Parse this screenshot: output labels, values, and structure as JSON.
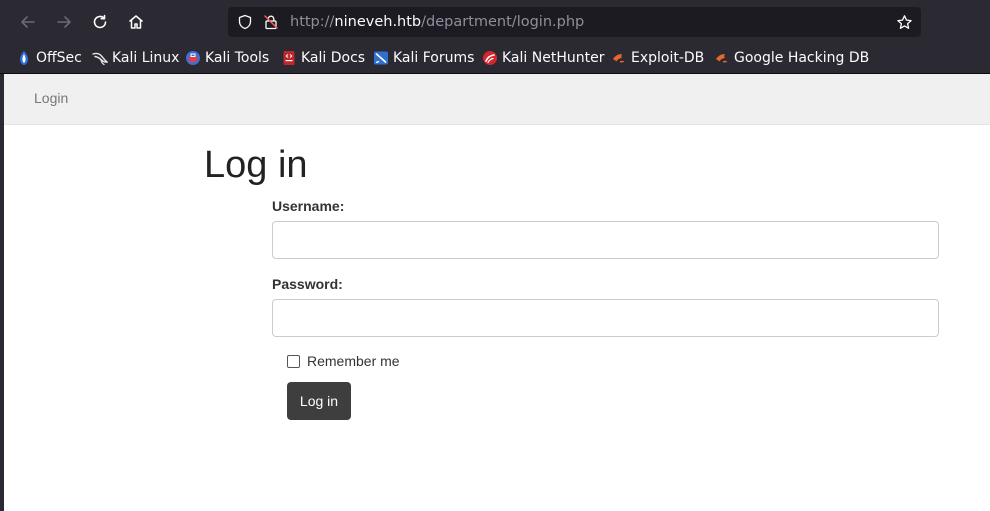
{
  "browser": {
    "url_scheme": "http://",
    "url_host": "nineveh.htb",
    "url_path": "/department/login.php",
    "bookmarks": [
      {
        "label": "OffSec",
        "icon": "offsec-icon",
        "color": "#2b6cd8"
      },
      {
        "label": "Kali Linux",
        "icon": "kali-dragon-icon",
        "color": "#1a1a1a"
      },
      {
        "label": "Kali Tools",
        "icon": "kali-tools-icon",
        "color": "#3b6fd6"
      },
      {
        "label": "Kali Docs",
        "icon": "kali-docs-icon",
        "color": "#c0272d"
      },
      {
        "label": "Kali Forums",
        "icon": "kali-forums-icon",
        "color": "#2f6fd0"
      },
      {
        "label": "Kali NetHunter",
        "icon": "nethunter-icon",
        "color": "#d3262e"
      },
      {
        "label": "Exploit-DB",
        "icon": "exploit-db-icon",
        "color": "#e7662b"
      },
      {
        "label": "Google Hacking DB",
        "icon": "ghdb-icon",
        "color": "#e7662b"
      }
    ]
  },
  "page": {
    "nav_login": "Login",
    "heading": "Log in",
    "username_label": "Username:",
    "username_value": "",
    "password_label": "Password:",
    "password_value": "",
    "remember_label": "Remember me",
    "remember_checked": false,
    "submit_label": "Log in",
    "button_color": "#3e3e3e"
  }
}
